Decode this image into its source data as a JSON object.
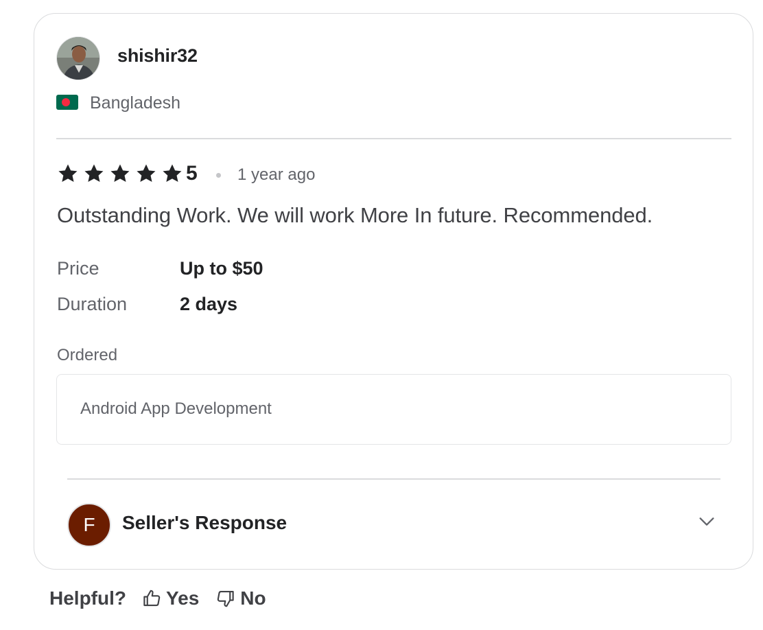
{
  "review": {
    "username": "shishir32",
    "country": "Bangladesh",
    "rating": "5",
    "time_ago": "1 year ago",
    "text": "Outstanding Work. We will work More In future. Recommended.",
    "price_label": "Price",
    "price_value": "Up to $50",
    "duration_label": "Duration",
    "duration_value": "2 days",
    "ordered_label": "Ordered",
    "ordered_value": "Android App Development"
  },
  "seller": {
    "initial": "F",
    "response_label": "Seller's Response"
  },
  "helpful": {
    "label": "Helpful?",
    "yes": "Yes",
    "no": "No"
  },
  "icons": {
    "star": "star-icon",
    "chevron": "chevron-down-icon",
    "thumbs_up": "thumbs-up-icon",
    "thumbs_down": "thumbs-down-icon",
    "flag": "bangladesh-flag-icon"
  },
  "colors": {
    "star": "#222325",
    "flag_green": "#006a4e",
    "flag_red": "#f42a41",
    "seller_avatar_bg": "#6b1d00"
  }
}
